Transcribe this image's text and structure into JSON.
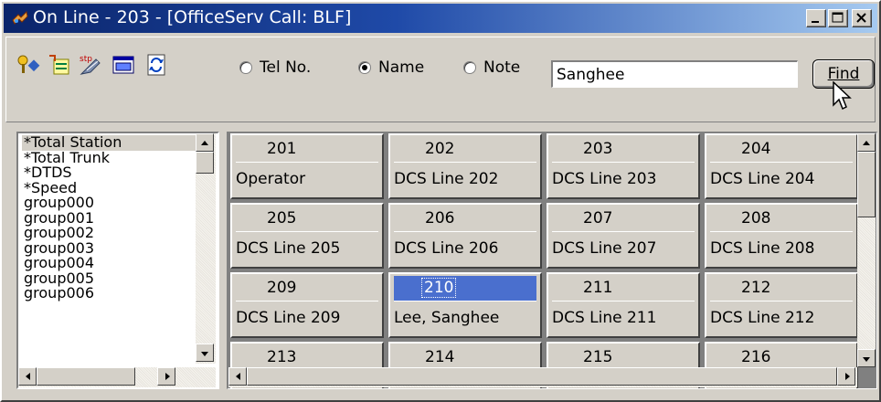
{
  "window": {
    "title": "On Line - 203 - [OfficeServ Call: BLF]"
  },
  "toolbar": {
    "icons": [
      "key-icon",
      "directory-icon",
      "speed-dial-icon",
      "window-icon",
      "refresh-icon"
    ]
  },
  "search": {
    "options": [
      {
        "label": "Tel No.",
        "checked": false
      },
      {
        "label": "Name",
        "checked": true
      },
      {
        "label": "Note",
        "checked": false
      }
    ],
    "value": "Sanghee",
    "find_label": "Find"
  },
  "groups": [
    "*Total Station",
    "*Total Trunk",
    "*DTDS",
    "*Speed",
    "group000",
    "group001",
    "group002",
    "group003",
    "group004",
    "group005",
    "group006"
  ],
  "stations": [
    {
      "number": "201",
      "name": "Operator"
    },
    {
      "number": "202",
      "name": "DCS Line 202"
    },
    {
      "number": "203",
      "name": "DCS Line 203"
    },
    {
      "number": "204",
      "name": "DCS Line 204"
    },
    {
      "number": "205",
      "name": "DCS Line 205"
    },
    {
      "number": "206",
      "name": "DCS Line 206"
    },
    {
      "number": "207",
      "name": "DCS Line 207"
    },
    {
      "number": "208",
      "name": "DCS Line 208"
    },
    {
      "number": "209",
      "name": "DCS Line 209"
    },
    {
      "number": "210",
      "name": "Lee, Sanghee"
    },
    {
      "number": "211",
      "name": "DCS Line 211"
    },
    {
      "number": "212",
      "name": "DCS Line 212"
    },
    {
      "number": "213",
      "name": ""
    },
    {
      "number": "214",
      "name": ""
    },
    {
      "number": "215",
      "name": ""
    },
    {
      "number": "216",
      "name": ""
    }
  ],
  "selected_station": "210"
}
